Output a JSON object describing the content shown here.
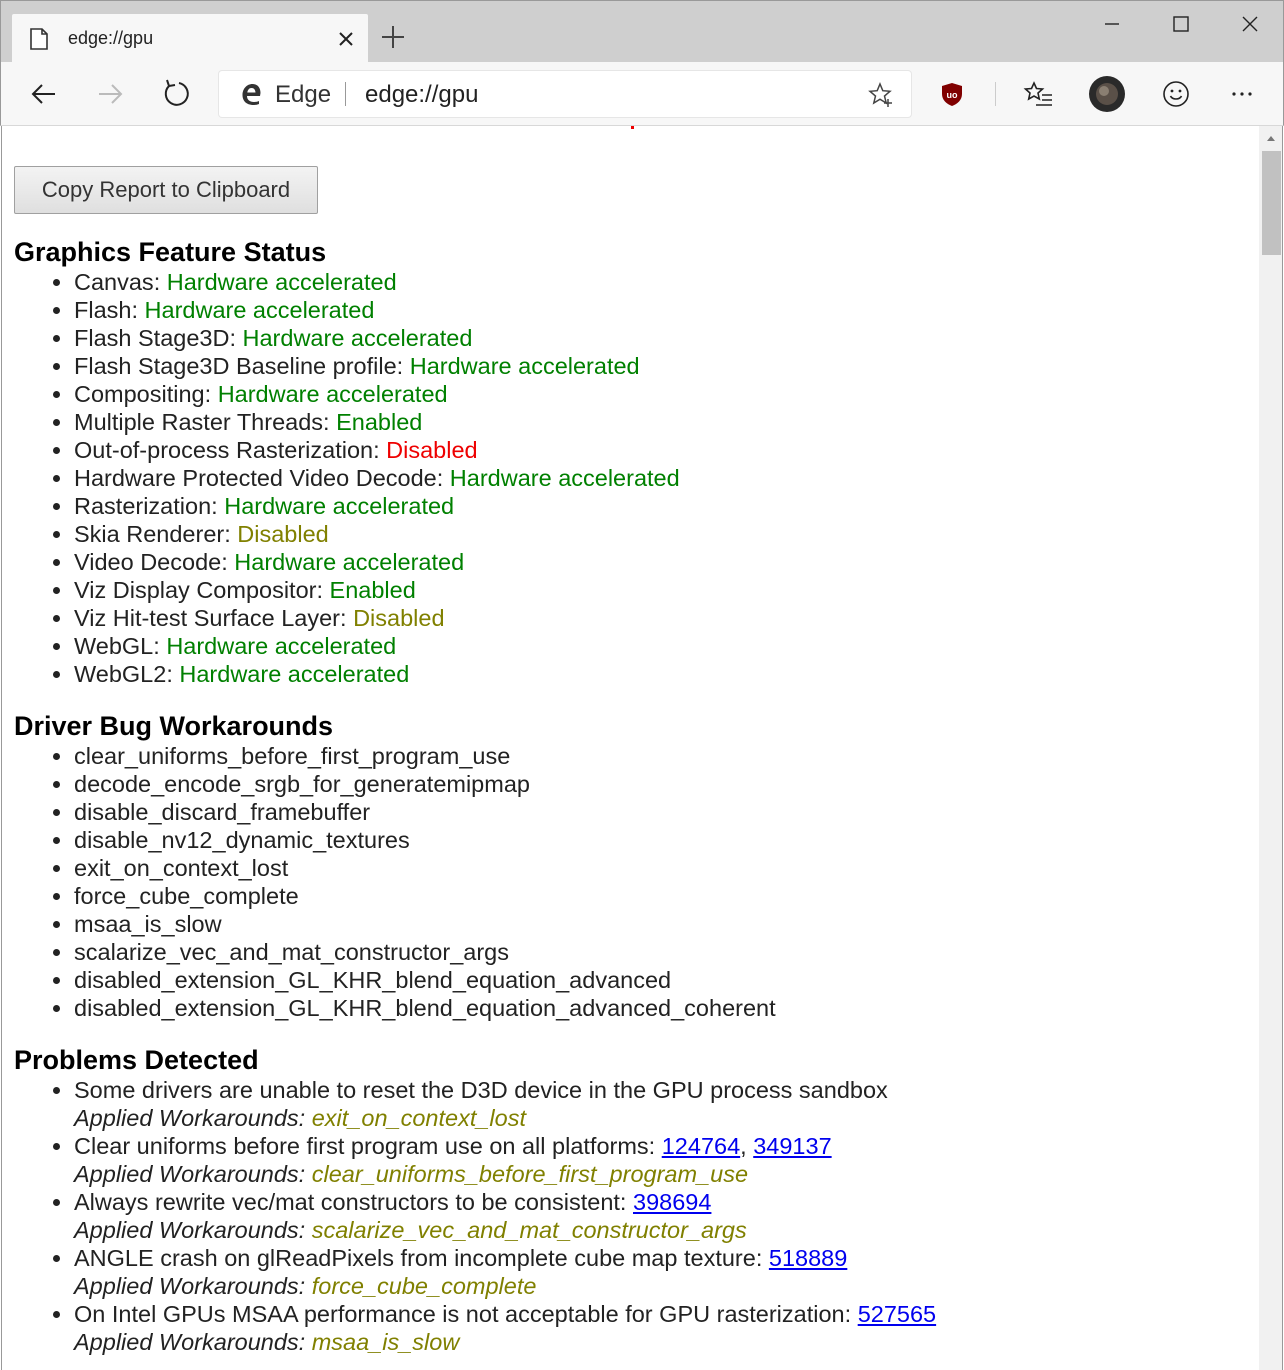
{
  "browser": {
    "tab_title": "edge://gpu",
    "site_identity": "Edge",
    "url": "edge://gpu",
    "accent_ublock": "#800000"
  },
  "page": {
    "copy_button_label": "Copy Report to Clipboard",
    "sections": {
      "feature_status": {
        "heading": "Graphics Feature Status",
        "items": [
          {
            "name": "Canvas",
            "status": "Hardware accelerated",
            "color": "green"
          },
          {
            "name": "Flash",
            "status": "Hardware accelerated",
            "color": "green"
          },
          {
            "name": "Flash Stage3D",
            "status": "Hardware accelerated",
            "color": "green"
          },
          {
            "name": "Flash Stage3D Baseline profile",
            "status": "Hardware accelerated",
            "color": "green"
          },
          {
            "name": "Compositing",
            "status": "Hardware accelerated",
            "color": "green"
          },
          {
            "name": "Multiple Raster Threads",
            "status": "Enabled",
            "color": "green"
          },
          {
            "name": "Out-of-process Rasterization",
            "status": "Disabled",
            "color": "red"
          },
          {
            "name": "Hardware Protected Video Decode",
            "status": "Hardware accelerated",
            "color": "green"
          },
          {
            "name": "Rasterization",
            "status": "Hardware accelerated",
            "color": "green"
          },
          {
            "name": "Skia Renderer",
            "status": "Disabled",
            "color": "olive"
          },
          {
            "name": "Video Decode",
            "status": "Hardware accelerated",
            "color": "green"
          },
          {
            "name": "Viz Display Compositor",
            "status": "Enabled",
            "color": "green"
          },
          {
            "name": "Viz Hit-test Surface Layer",
            "status": "Disabled",
            "color": "olive"
          },
          {
            "name": "WebGL",
            "status": "Hardware accelerated",
            "color": "green"
          },
          {
            "name": "WebGL2",
            "status": "Hardware accelerated",
            "color": "green"
          }
        ]
      },
      "workarounds": {
        "heading": "Driver Bug Workarounds",
        "items": [
          "clear_uniforms_before_first_program_use",
          "decode_encode_srgb_for_generatemipmap",
          "disable_discard_framebuffer",
          "disable_nv12_dynamic_textures",
          "exit_on_context_lost",
          "force_cube_complete",
          "msaa_is_slow",
          "scalarize_vec_and_mat_constructor_args",
          "disabled_extension_GL_KHR_blend_equation_advanced",
          "disabled_extension_GL_KHR_blend_equation_advanced_coherent"
        ]
      },
      "problems": {
        "heading": "Problems Detected",
        "applied_label": "Applied Workarounds:",
        "items": [
          {
            "text": "Some drivers are unable to reset the D3D device in the GPU process sandbox",
            "links": [],
            "workaround": "exit_on_context_lost"
          },
          {
            "text": "Clear uniforms before first program use on all platforms:",
            "links": [
              "124764",
              "349137"
            ],
            "workaround": "clear_uniforms_before_first_program_use"
          },
          {
            "text": "Always rewrite vec/mat constructors to be consistent:",
            "links": [
              "398694"
            ],
            "workaround": "scalarize_vec_and_mat_constructor_args"
          },
          {
            "text": "ANGLE crash on glReadPixels from incomplete cube map texture:",
            "links": [
              "518889"
            ],
            "workaround": "force_cube_complete"
          },
          {
            "text": "On Intel GPUs MSAA performance is not acceptable for GPU rasterization:",
            "links": [
              "527565"
            ],
            "workaround": "msaa_is_slow"
          }
        ]
      }
    }
  }
}
